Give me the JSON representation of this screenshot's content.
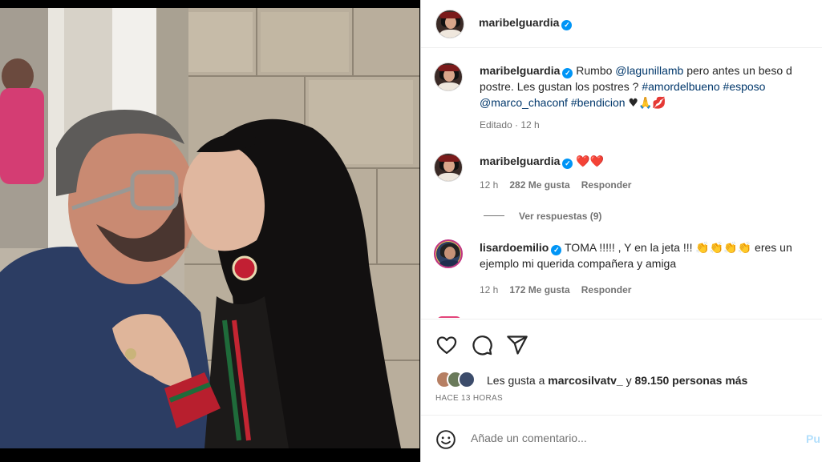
{
  "post": {
    "author": "maribelguardia"
  },
  "caption": {
    "author": "maribelguardia",
    "line1_text": "Rumbo ",
    "mention1": "@lagunillamb",
    "line1_rest": " pero antes un beso d",
    "line2_text": "postre. Les gustan los postres ? ",
    "hashtag1": "#amordelbueno",
    "hashtag2": "#esposo",
    "mention2": "@marco_chaconf",
    "hashtag3": "#bendicion",
    "emojis": "♥🙏💋",
    "meta": "Editado · 12 h"
  },
  "comments": [
    {
      "author": "maribelguardia",
      "text": "❤️❤️",
      "time": "12 h",
      "likes": "282 Me gusta",
      "reply": "Responder"
    },
    {
      "author": "lisardoemilio",
      "text_line1": "TOMA !!!!! , Y en la jeta !!! 👏👏👏👏 eres un",
      "text_line2": "ejemplo mi querida compañera y amiga",
      "time": "12 h",
      "likes": "172 Me gusta",
      "reply": "Responder"
    }
  ],
  "replies_toggle": "Ver respuestas (9)",
  "likes": {
    "prefix": "Les gusta a ",
    "user": "marcosilvatv_",
    "middle": " y ",
    "count": "89.150 personas más"
  },
  "timestamp": "HACE 13 HORAS",
  "composer": {
    "placeholder": "Añade un comentario...",
    "post_label": "Pu"
  },
  "icons": [
    "heart-icon",
    "comment-icon",
    "share-icon",
    "emoji-icon",
    "verified-icon"
  ],
  "colors": {
    "link": "#00376b",
    "verified": "#0095f6",
    "muted": "#737373",
    "post_button": "#b2dffc"
  }
}
